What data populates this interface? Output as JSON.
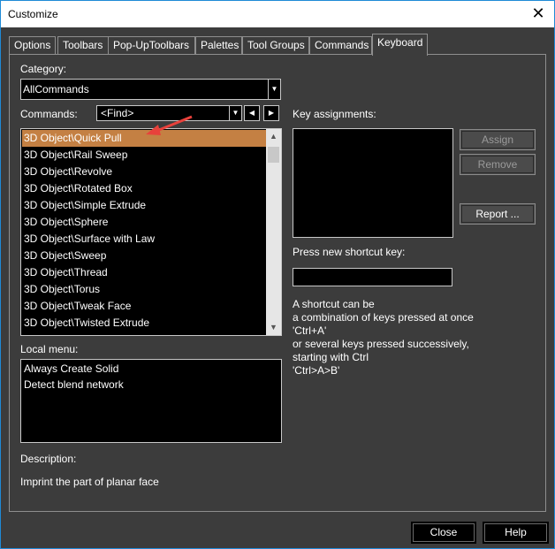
{
  "window": {
    "title": "Customize"
  },
  "tabs": [
    {
      "label": "Options"
    },
    {
      "label": "Toolbars"
    },
    {
      "label": "Pop-UpToolbars"
    },
    {
      "label": "Palettes"
    },
    {
      "label": "Tool Groups"
    },
    {
      "label": "Commands"
    },
    {
      "label": "Keyboard"
    }
  ],
  "category": {
    "label": "Category:",
    "value": "AllCommands"
  },
  "commands": {
    "label": "Commands:",
    "find_value": "<Find>",
    "items": [
      "3D Object\\Quick Pull",
      "3D Object\\Rail Sweep",
      "3D Object\\Revolve",
      "3D Object\\Rotated Box",
      "3D Object\\Simple Extrude",
      "3D Object\\Sphere",
      "3D Object\\Surface with Law",
      "3D Object\\Sweep",
      "3D Object\\Thread",
      "3D Object\\Torus",
      "3D Object\\Tweak Face",
      "3D Object\\Twisted Extrude"
    ],
    "selected": "3D Object\\Quick Pull"
  },
  "local_menu": {
    "label": "Local menu:",
    "items": [
      "Always Create Solid",
      "Detect blend network"
    ]
  },
  "description": {
    "label": "Description:",
    "text": "Imprint the part of planar face"
  },
  "key_assignments": {
    "label": "Key assignments:"
  },
  "buttons": {
    "assign": "Assign",
    "remove": "Remove",
    "report": "Report ...",
    "close": "Close",
    "help": "Help"
  },
  "shortcut": {
    "label": "Press new shortcut key:",
    "help_lines": [
      "A shortcut can be",
      "a combination of keys pressed at once",
      "'Ctrl+A'",
      "or several keys pressed successively,",
      "starting with Ctrl",
      "'Ctrl>A>B'"
    ]
  },
  "colors": {
    "selection": "#c48043",
    "arrow": "#e8413b",
    "background": "#3c3c3c"
  }
}
